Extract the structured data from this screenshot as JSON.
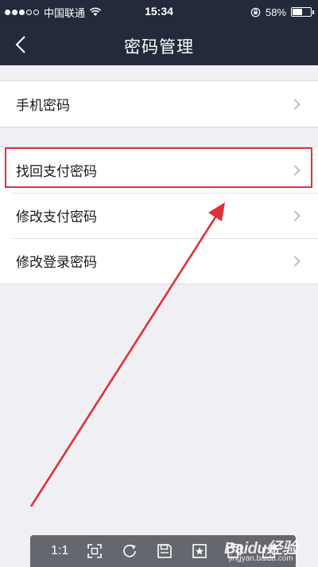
{
  "status_bar": {
    "carrier": "中国联通",
    "time": "15:34",
    "battery": "58%",
    "battery_level": 0.58
  },
  "nav": {
    "title": "密码管理"
  },
  "groups": [
    {
      "items": [
        {
          "label": "手机密码"
        }
      ]
    },
    {
      "items": [
        {
          "label": "找回支付密码",
          "highlighted": true
        },
        {
          "label": "修改支付密码"
        },
        {
          "label": "修改登录密码"
        }
      ]
    }
  ],
  "toolbar": {
    "zoom_label": "1:1"
  },
  "watermark": {
    "brand": "Baidu经验",
    "url": "jingyan.baidu.com"
  },
  "colors": {
    "header_bg": "#232a3b",
    "page_bg": "#f0f0f4",
    "highlight": "#e0303a"
  }
}
